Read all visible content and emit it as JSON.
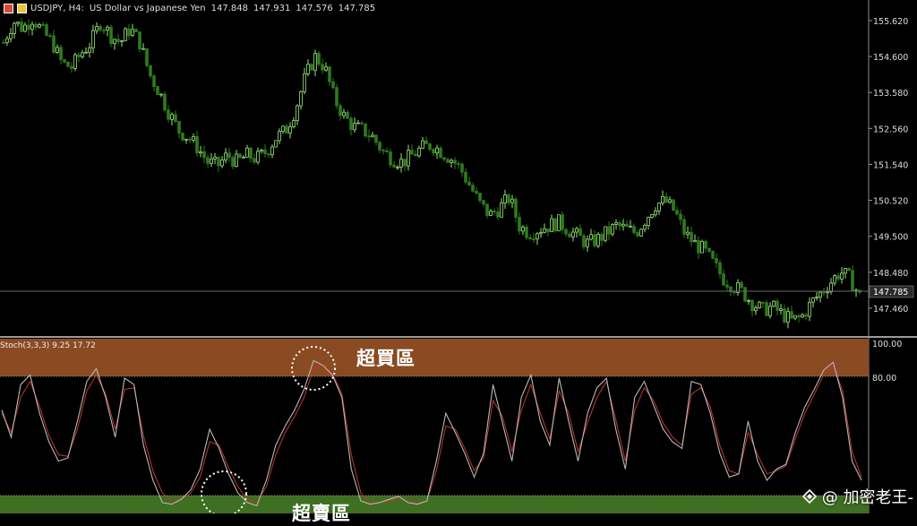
{
  "header": {
    "symbol_timeframe": "USDJPY, H4:",
    "description": "US Dollar vs Japanese Yen",
    "open": "147.848",
    "high": "147.931",
    "low": "147.576",
    "close": "147.785"
  },
  "price_axis": {
    "ticks": [
      "155.620",
      "154.600",
      "153.580",
      "152.560",
      "151.540",
      "150.520",
      "149.500",
      "148.480",
      "147.460"
    ],
    "current_price": "147.785"
  },
  "stoch": {
    "label": "Stoch(3,3,3) 9.25 17.72",
    "axis_ticks": [
      "100.00",
      "80.00"
    ],
    "overbought_label": "超買區",
    "oversold_label": "超賣區"
  },
  "watermark": {
    "text": "@ 加密老王-"
  },
  "colors": {
    "background": "#000000",
    "bull_candle": "#9be27a",
    "bear_candle": "#2f7a1e",
    "overbought_zone": "#8a4a22",
    "oversold_zone": "#3f6f22",
    "stoch_main": "#b8b8b8",
    "stoch_signal": "#c0392b",
    "price_line": "#6a6a6a"
  },
  "chart_data": {
    "type": "candlestick",
    "close_path": [
      155.0,
      155.6,
      155.4,
      155.7,
      155.3,
      155.0,
      154.4,
      154.3,
      154.7,
      155.0,
      155.6,
      155.2,
      155.0,
      155.4,
      155.0,
      154.1,
      153.6,
      153.0,
      152.5,
      152.3,
      152.0,
      151.6,
      151.5,
      151.8,
      151.6,
      151.8,
      151.7,
      151.9,
      152.3,
      152.5,
      153.1,
      154.0,
      154.6,
      154.3,
      153.4,
      152.9,
      152.6,
      152.5,
      152.3,
      151.9,
      151.7,
      151.6,
      151.8,
      152.0,
      152.1,
      151.9,
      151.7,
      151.4,
      150.9,
      150.4,
      150.1,
      150.3,
      150.6,
      149.8,
      149.6,
      149.7,
      149.8,
      149.9,
      149.7,
      149.5,
      149.3,
      149.4,
      149.6,
      149.8,
      149.7,
      149.6,
      150.0,
      150.4,
      150.5,
      150.2,
      149.6,
      149.3,
      149.1,
      148.7,
      148.3,
      148.1,
      147.9,
      147.6,
      147.4,
      147.5,
      147.3,
      147.1,
      147.2,
      147.6,
      147.9,
      148.2,
      148.5,
      148.3,
      147.8
    ],
    "stoch_main": [
      62,
      45,
      78,
      84,
      60,
      42,
      30,
      32,
      55,
      80,
      88,
      70,
      45,
      82,
      78,
      40,
      18,
      4,
      3,
      6,
      12,
      25,
      50,
      38,
      22,
      10,
      4,
      2,
      18,
      40,
      52,
      62,
      75,
      93,
      90,
      84,
      70,
      25,
      5,
      3,
      4,
      6,
      8,
      4,
      3,
      5,
      30,
      60,
      48,
      35,
      20,
      35,
      78,
      54,
      30,
      70,
      84,
      55,
      40,
      82,
      55,
      30,
      60,
      76,
      82,
      50,
      25,
      70,
      80,
      65,
      50,
      42,
      38,
      80,
      78,
      60,
      35,
      20,
      22,
      55,
      30,
      18,
      25,
      28,
      48,
      64,
      75,
      87,
      92,
      70,
      30,
      18
    ],
    "stoch_signal": [
      60,
      48,
      70,
      80,
      64,
      46,
      34,
      33,
      50,
      74,
      84,
      72,
      50,
      75,
      76,
      46,
      24,
      10,
      5,
      6,
      10,
      20,
      42,
      40,
      26,
      14,
      6,
      4,
      14,
      34,
      48,
      58,
      70,
      88,
      90,
      85,
      72,
      34,
      10,
      4,
      4,
      5,
      7,
      5,
      4,
      5,
      24,
      52,
      50,
      38,
      24,
      32,
      68,
      58,
      36,
      62,
      78,
      60,
      44,
      74,
      60,
      36,
      54,
      70,
      80,
      56,
      30,
      62,
      76,
      68,
      54,
      45,
      40,
      72,
      76,
      64,
      40,
      24,
      22,
      48,
      34,
      22,
      24,
      27,
      44,
      60,
      72,
      84,
      90,
      74,
      36,
      20
    ],
    "price_ylim": [
      146.9,
      156.0
    ],
    "stoch_ylim": [
      0,
      100
    ]
  }
}
